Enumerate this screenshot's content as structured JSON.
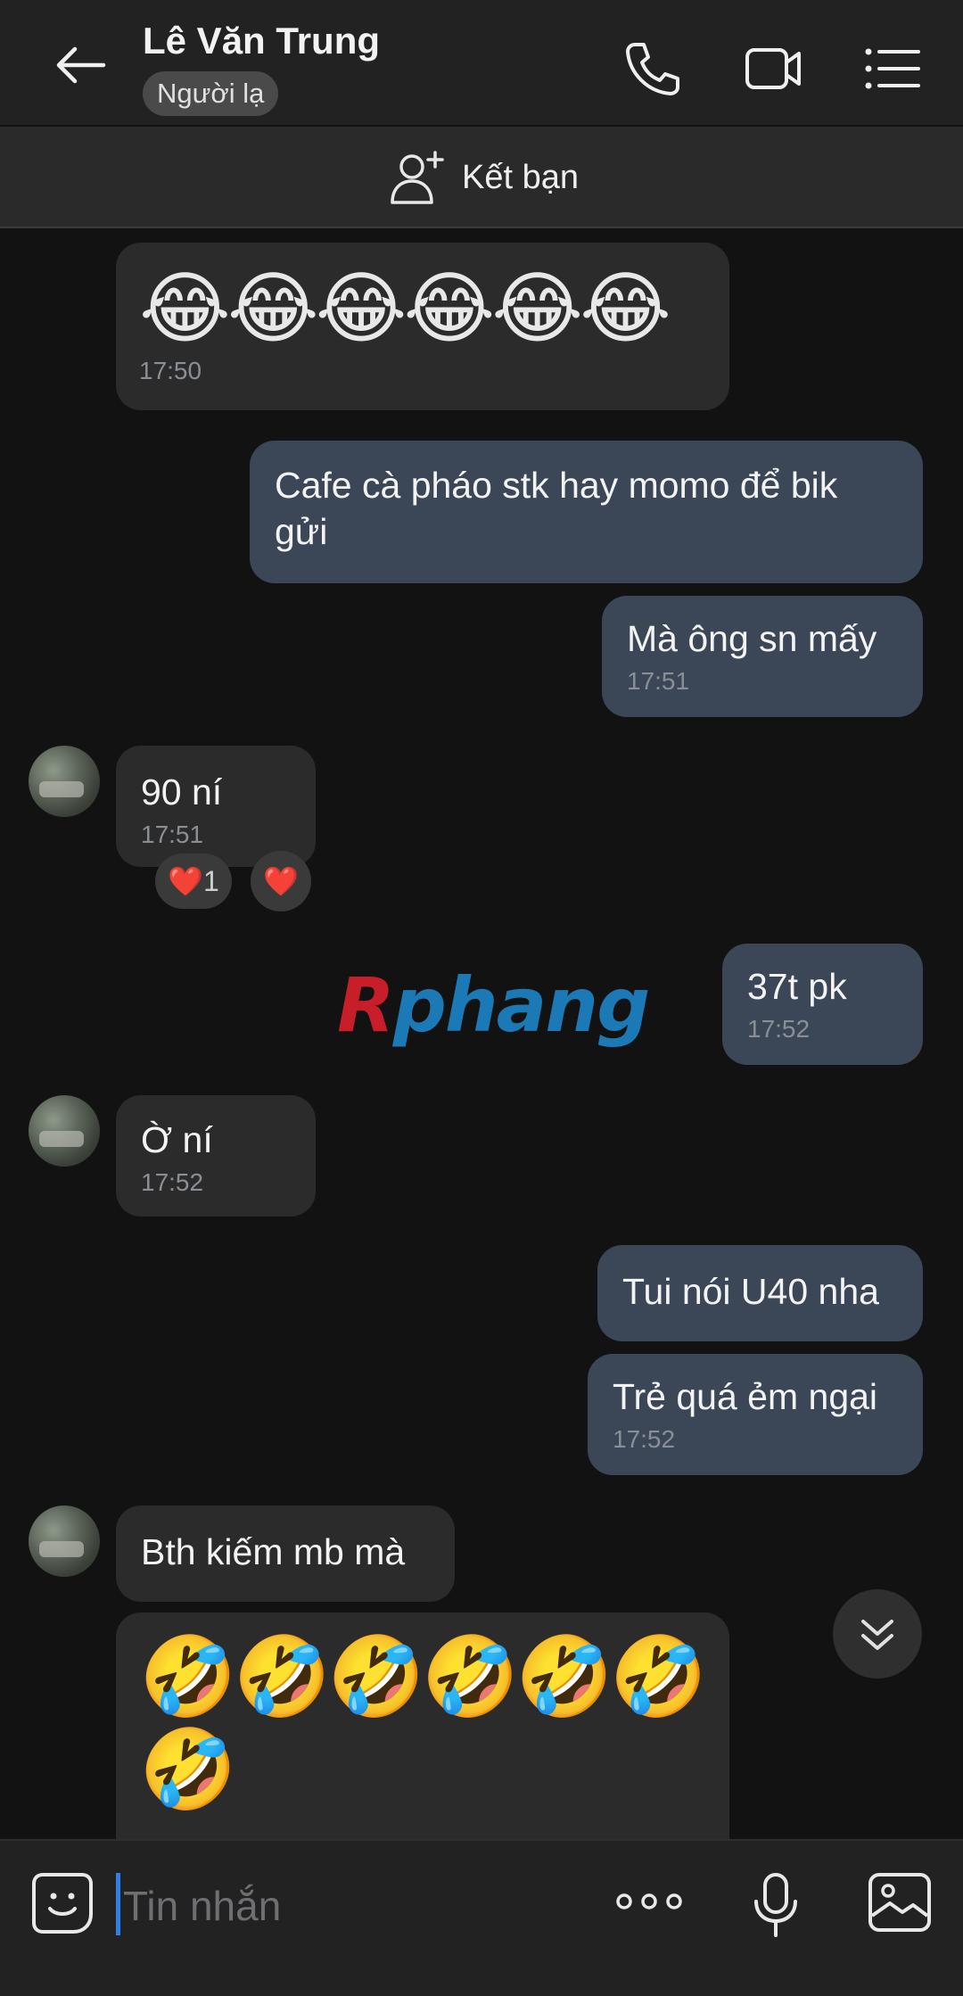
{
  "header": {
    "contact_name": "Lê Văn Trung",
    "badge": "Người lạ"
  },
  "add_friend": {
    "label": "Kết bạn"
  },
  "messages": [
    {
      "dir": "in",
      "emoji": "😂😂😂😂😂😂",
      "time": "17:50"
    },
    {
      "dir": "out",
      "text": "Cafe cà pháo stk hay momo để bik gửi"
    },
    {
      "dir": "out",
      "text": "Mà ông sn mấy",
      "time": "17:51"
    },
    {
      "dir": "in",
      "text": "90 ní",
      "time": "17:51",
      "reactions": {
        "heart_count": "1",
        "heart": "❤️",
        "heart_alt": "❤️"
      }
    },
    {
      "dir": "out",
      "text": "37t pk",
      "time": "17:52"
    },
    {
      "dir": "in",
      "text": "Ờ ní",
      "time": "17:52"
    },
    {
      "dir": "out",
      "text": "Tui nói U40 nha"
    },
    {
      "dir": "out",
      "text": "Trẻ quá ẻm ngại",
      "time": "17:52"
    },
    {
      "dir": "in",
      "text": "Bth kiếm mb mà"
    },
    {
      "dir": "in",
      "emoji_line1": "🤣🤣🤣🤣🤣🤣",
      "emoji_line2": "🤣"
    }
  ],
  "watermark": {
    "first": "R",
    "rest": "phang"
  },
  "composer": {
    "placeholder": "Tin nhắn"
  }
}
